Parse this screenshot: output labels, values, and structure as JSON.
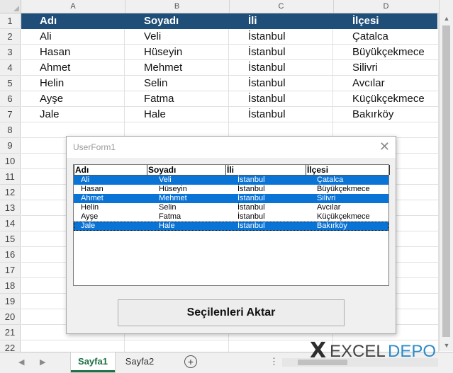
{
  "columns": [
    "A",
    "B",
    "C",
    "D"
  ],
  "rows": [
    "1",
    "2",
    "3",
    "4",
    "5",
    "6",
    "7",
    "8",
    "9",
    "10",
    "11",
    "12",
    "13",
    "14",
    "15",
    "16",
    "17",
    "18",
    "19",
    "20",
    "21",
    "22"
  ],
  "sheet": {
    "headers": [
      "Adı",
      "Soyadı",
      "İli",
      "İlçesi"
    ],
    "data": [
      [
        "Ali",
        "Veli",
        "İstanbul",
        "Çatalca"
      ],
      [
        "Hasan",
        "Hüseyin",
        "İstanbul",
        "Büyükçekmece"
      ],
      [
        "Ahmet",
        "Mehmet",
        "İstanbul",
        "Silivri"
      ],
      [
        "Helin",
        "Selin",
        "İstanbul",
        "Avcılar"
      ],
      [
        "Ayşe",
        "Fatma",
        "İstanbul",
        "Küçükçekmece"
      ],
      [
        "Jale",
        "Hale",
        "İstanbul",
        "Bakırköy"
      ]
    ],
    "header_color": "#1f4e79"
  },
  "userform": {
    "title": "UserForm1",
    "close_icon": "close-icon",
    "listbox": {
      "headers": [
        "Adı",
        "Soyadı",
        "İli",
        "İlçesi"
      ],
      "rows": [
        {
          "cells": [
            "Ali",
            "Veli",
            "İstanbul",
            "Çatalca"
          ],
          "selected": true
        },
        {
          "cells": [
            "Hasan",
            "Hüseyin",
            "İstanbul",
            "Büyükçekmece"
          ],
          "selected": false
        },
        {
          "cells": [
            "Ahmet",
            "Mehmet",
            "İstanbul",
            "Silivri"
          ],
          "selected": true
        },
        {
          "cells": [
            "Helin",
            "Selin",
            "İstanbul",
            "Avcılar"
          ],
          "selected": false
        },
        {
          "cells": [
            "Ayşe",
            "Fatma",
            "İstanbul",
            "Küçükçekmece"
          ],
          "selected": false
        },
        {
          "cells": [
            "Jale",
            "Hale",
            "İstanbul",
            "Bakırköy"
          ],
          "selected": true
        }
      ],
      "selection_color": "#0a73d6"
    },
    "button_label": "Seçilenleri Aktar"
  },
  "tabs": {
    "sheets": [
      "Sayfa1",
      "Sayfa2"
    ],
    "active": "Sayfa1",
    "add_icon": "plus-circle-icon",
    "more_icon": "more-dots-icon"
  },
  "watermark": {
    "x": "X",
    "excel": "EXCEL",
    "depo": "DEPO"
  }
}
